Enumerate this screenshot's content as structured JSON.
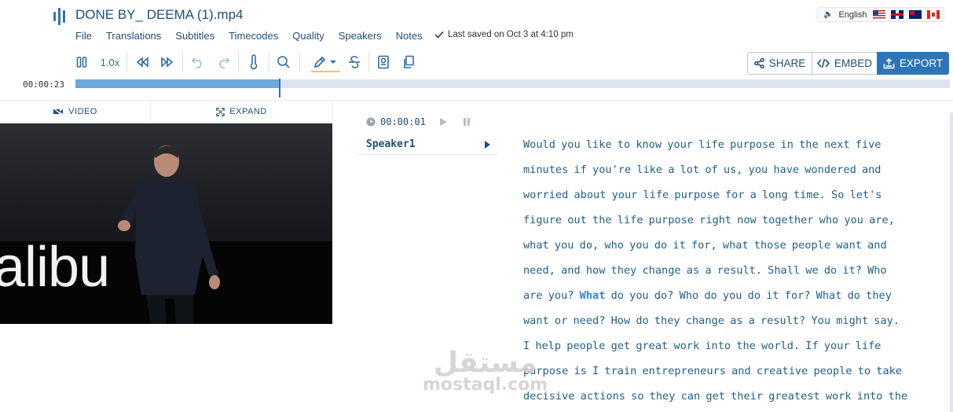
{
  "header": {
    "title": "DONE BY_ DEEMA (1).mp4",
    "language": "English",
    "flags": [
      "us-flag-icon",
      "uk-flag-icon",
      "au-flag-icon",
      "ca-flag-icon"
    ],
    "menu": [
      "File",
      "Translations",
      "Subtitles",
      "Timecodes",
      "Quality",
      "Speakers",
      "Notes"
    ],
    "saved_status": "Last saved on Oct 3 at 4:10 pm"
  },
  "toolbar": {
    "speed": "1.0x",
    "share_label": "SHARE",
    "embed_label": "EMBED",
    "export_label": "EXPORT"
  },
  "playback": {
    "current_time": "00:00:23",
    "progress_fraction": 0.233
  },
  "video_panel": {
    "video_tab": "VIDEO",
    "expand_tab": "EXPAND",
    "stage_text": "alibu"
  },
  "transcript": {
    "segment_time": "00:00:01",
    "speaker": "Speaker1",
    "text_before": "Would you like to know your life purpose in the next five\nminutes if you're like a lot of us, you have wondered and\nworried about your life purpose for a long time. So let's\nfigure out the life purpose right now together who you are,\nwhat you do, who you do it for, what those people want and\nneed, and how they change as a result. Shall we do it? Who\nare you? ",
    "current_word": "What",
    "text_after": " do you do? Who do you do it for? What do they\nwant or need? How do they change as a result? You might say.\nI help people get great work into the world. If your life\npurpose is I train entrepreneurs and creative people to take\ndecisive actions so they can get their greatest work into the"
  },
  "watermark": {
    "arabic": "مستقل",
    "latin": "mostaql.com"
  },
  "colors": {
    "primary": "#2e75b6",
    "text": "#1f4e79",
    "progress_fill": "#6fa8dc",
    "progress_track": "#dfe3ef",
    "highlight": "#f5c542"
  }
}
